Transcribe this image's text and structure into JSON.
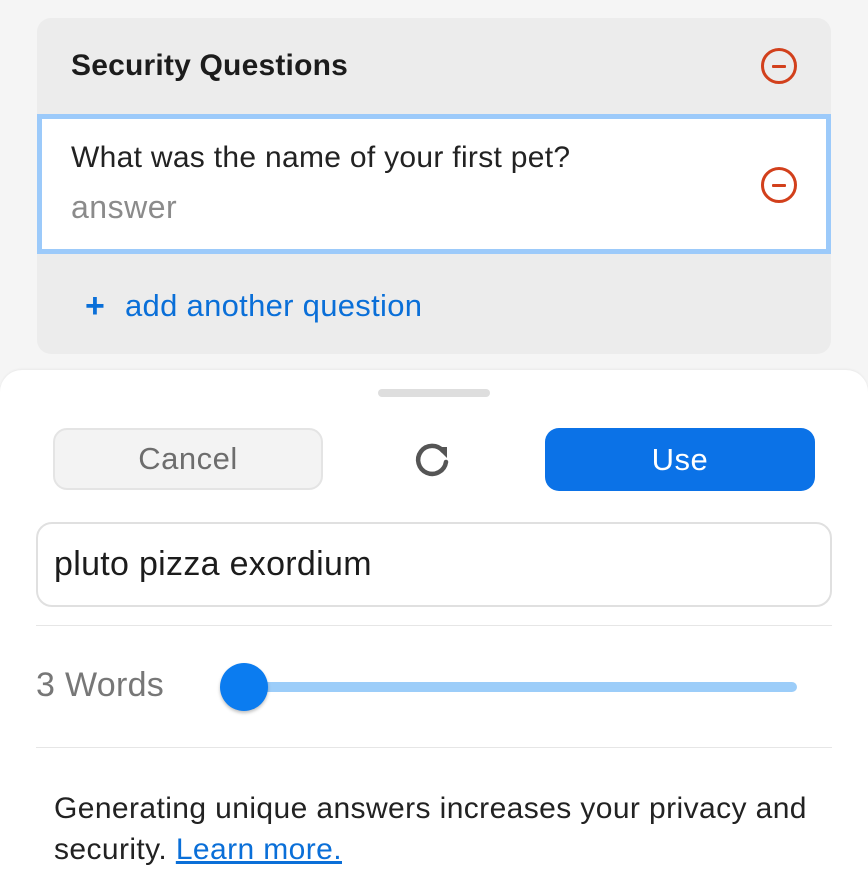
{
  "security_questions": {
    "title": "Security Questions",
    "questions": [
      {
        "question": "What was the name of your first pet?",
        "answer_placeholder": "answer"
      }
    ],
    "add_question_label": "add another question"
  },
  "sheet": {
    "cancel_label": "Cancel",
    "use_label": "Use",
    "generated_answer": "pluto pizza exordium",
    "word_count_label": "3 Words",
    "word_slider_level": 0.0,
    "info_text": "Generating unique answers increases your privacy and security.",
    "learn_more_label": "Learn more."
  },
  "icons": {
    "remove": "minus-circle-icon",
    "add": "plus-icon",
    "refresh": "refresh-icon"
  },
  "colors": {
    "accent": "#0b72e7",
    "destructive": "#d2401c",
    "focus_border": "#9ccafa",
    "slider_track": "#9ccdf9"
  }
}
